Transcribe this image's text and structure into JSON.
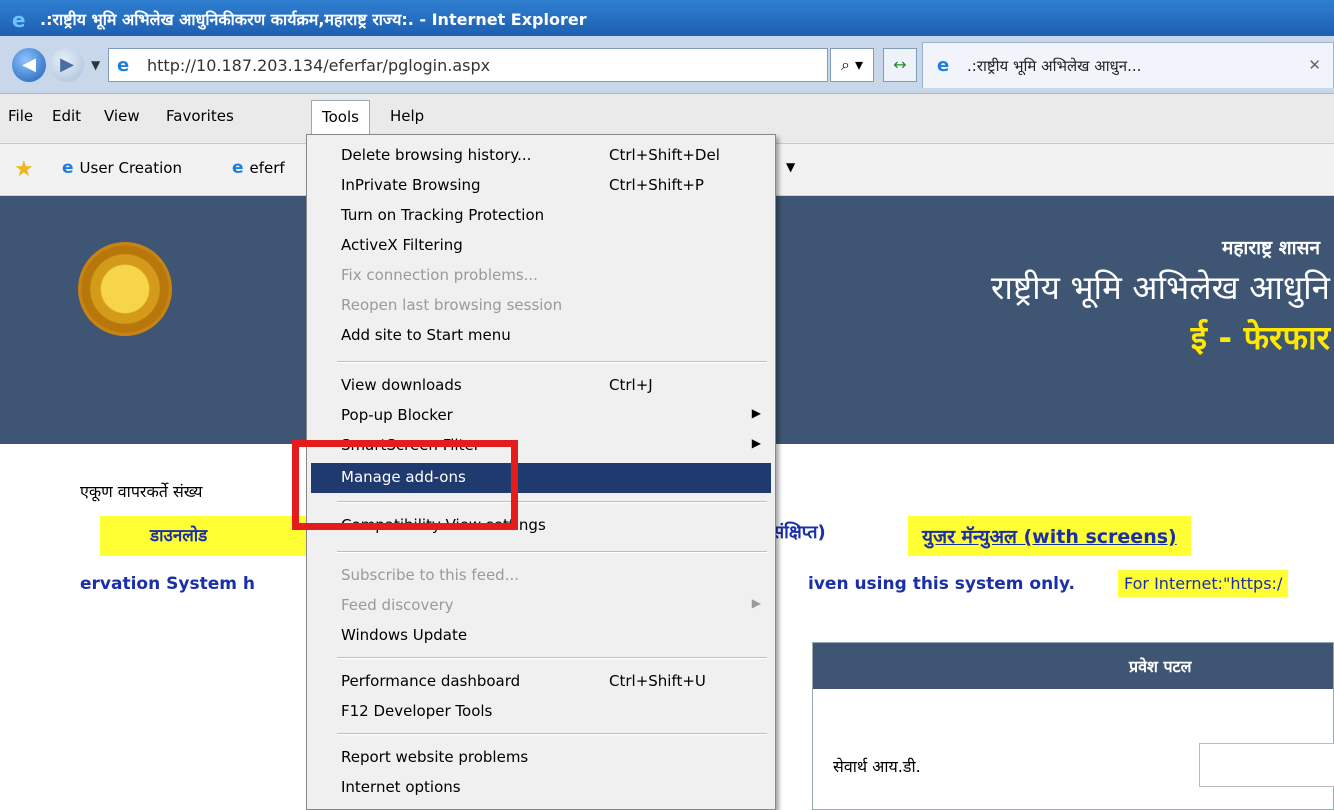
{
  "window": {
    "title": ".:राष्ट्रीय भूमि अभिलेख आधुनिकीकरण कार्यक्रम,महाराष्ट्र राज्य:. - Internet Explorer"
  },
  "navbar": {
    "url": "http://10.187.203.134/eferfar/pglogin.aspx",
    "tab_label": ".:राष्ट्रीय भूमि अभिलेख आधुन..."
  },
  "menubar": {
    "items": [
      "File",
      "Edit",
      "View",
      "Favorites",
      "Tools",
      "Help"
    ]
  },
  "favorites": {
    "items": [
      "User Creation",
      "eferf"
    ]
  },
  "tools_menu": {
    "items": [
      {
        "label": "Delete browsing history...",
        "shortcut": "Ctrl+Shift+Del"
      },
      {
        "label": "InPrivate Browsing",
        "shortcut": "Ctrl+Shift+P"
      },
      {
        "label": "Turn on Tracking Protection",
        "shortcut": ""
      },
      {
        "label": "ActiveX Filtering",
        "shortcut": ""
      },
      {
        "label": "Fix connection problems...",
        "shortcut": "",
        "disabled": true
      },
      {
        "label": "Reopen last browsing session",
        "shortcut": "",
        "disabled": true
      },
      {
        "label": "Add site to Start menu",
        "shortcut": ""
      },
      {
        "label": "View downloads",
        "shortcut": "Ctrl+J"
      },
      {
        "label": "Pop-up Blocker",
        "shortcut": "",
        "submenu": true
      },
      {
        "label": "SmartScreen Filter",
        "shortcut": "",
        "submenu": true
      },
      {
        "label": "Manage add-ons",
        "shortcut": "",
        "highlighted": true
      },
      {
        "label": "Compatibility View settings",
        "shortcut": ""
      },
      {
        "label": "Subscribe to this feed...",
        "shortcut": "",
        "disabled": true
      },
      {
        "label": "Feed discovery",
        "shortcut": "",
        "disabled": true,
        "submenu": true
      },
      {
        "label": "Windows Update",
        "shortcut": ""
      },
      {
        "label": "Performance dashboard",
        "shortcut": "Ctrl+Shift+U"
      },
      {
        "label": "F12 Developer Tools",
        "shortcut": ""
      },
      {
        "label": "Report website problems",
        "shortcut": ""
      },
      {
        "label": "Internet options",
        "shortcut": ""
      }
    ]
  },
  "page": {
    "gov_name": "महाराष्ट्र शासन",
    "program_title": "राष्ट्रीय भूमि अभिलेख आधुनि",
    "app_title": "ई - फेरफार",
    "user_count_label": "एकूण वापरकर्ते संख्य",
    "download_label": "डाउनलोड",
    "summary_label": "संक्षिप्त)",
    "manual_label": "युजर मॅन्युअल (with screens)",
    "scroll_left": "ervation System h",
    "scroll_right": "iven using this system only.",
    "scroll_internet": "For Internet:\"https:/",
    "login_title": "प्रवेश पटल",
    "login_field_label": "सेवार्थ आय.डी."
  },
  "colors": {
    "banner": "#3e5573",
    "highlight": "#1f3a6e",
    "annotation": "#e51c1c",
    "link": "#1a2fa8",
    "marker": "#ffff33"
  }
}
